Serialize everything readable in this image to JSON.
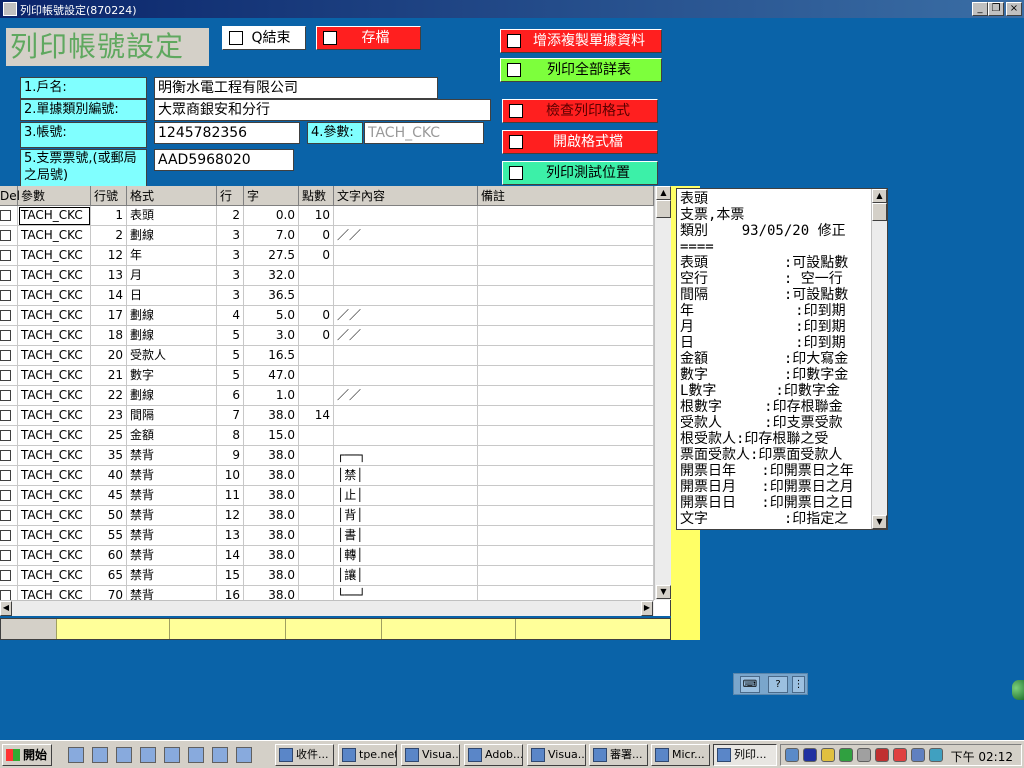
{
  "window": {
    "title": "列印帳號設定(870224)",
    "buttons": [
      "_",
      "❐",
      "×"
    ]
  },
  "form": {
    "title": "列印帳號設定",
    "buttons": {
      "quit": "Q結束",
      "save": "存檔",
      "add_copy": "增添複製單據資料",
      "print_all": "列印全部詳表",
      "check_format": "檢查列印格式",
      "open_format": "開啟格式檔",
      "print_test": "列印測試位置"
    },
    "fields": {
      "household_label": "1.戶名:",
      "household_value": "明衡水電工程有限公司",
      "doc_type_label": "2.單據類別編號:",
      "doc_type_value": "大眾商銀安和分行",
      "account_label": "3.帳號:",
      "account_value": "1245782356",
      "param_label": "4.參數:",
      "param_value": "TACH_CKC",
      "check_no_label": "5.支票票號,(或郵局之局號)",
      "check_no_value": "AAD5968020"
    }
  },
  "grid": {
    "columns": [
      "Del",
      "參數",
      "行號",
      "格式",
      "行",
      "字",
      "點數",
      "文字內容",
      "備註"
    ],
    "rows": [
      {
        "param": "TACH_CKC",
        "no": "1",
        "fmt": "表頭",
        "line": "2",
        "char": "0.0",
        "pts": "10",
        "text": ""
      },
      {
        "param": "TACH_CKC",
        "no": "2",
        "fmt": "劃線",
        "line": "3",
        "char": "7.0",
        "pts": "0",
        "text": "／／"
      },
      {
        "param": "TACH_CKC",
        "no": "12",
        "fmt": "年",
        "line": "3",
        "char": "27.5",
        "pts": "0",
        "text": ""
      },
      {
        "param": "TACH_CKC",
        "no": "13",
        "fmt": "月",
        "line": "3",
        "char": "32.0",
        "pts": "",
        "text": ""
      },
      {
        "param": "TACH_CKC",
        "no": "14",
        "fmt": "日",
        "line": "3",
        "char": "36.5",
        "pts": "",
        "text": ""
      },
      {
        "param": "TACH_CKC",
        "no": "17",
        "fmt": "劃線",
        "line": "4",
        "char": "5.0",
        "pts": "0",
        "text": "／／"
      },
      {
        "param": "TACH_CKC",
        "no": "18",
        "fmt": "劃線",
        "line": "5",
        "char": "3.0",
        "pts": "0",
        "text": "／／"
      },
      {
        "param": "TACH_CKC",
        "no": "20",
        "fmt": "受款人",
        "line": "5",
        "char": "16.5",
        "pts": "",
        "text": ""
      },
      {
        "param": "TACH_CKC",
        "no": "21",
        "fmt": "數字",
        "line": "5",
        "char": "47.0",
        "pts": "",
        "text": ""
      },
      {
        "param": "TACH_CKC",
        "no": "22",
        "fmt": "劃線",
        "line": "6",
        "char": "1.0",
        "pts": "",
        "text": "／／"
      },
      {
        "param": "TACH_CKC",
        "no": "23",
        "fmt": "間隔",
        "line": "7",
        "char": "38.0",
        "pts": "14",
        "text": ""
      },
      {
        "param": "TACH_CKC",
        "no": "25",
        "fmt": "金額",
        "line": "8",
        "char": "15.0",
        "pts": "",
        "text": ""
      },
      {
        "param": "TACH_CKC",
        "no": "35",
        "fmt": "禁背",
        "line": "9",
        "char": "38.0",
        "pts": "",
        "text": "┌──┐"
      },
      {
        "param": "TACH_CKC",
        "no": "40",
        "fmt": "禁背",
        "line": "10",
        "char": "38.0",
        "pts": "",
        "text": "│禁│"
      },
      {
        "param": "TACH_CKC",
        "no": "45",
        "fmt": "禁背",
        "line": "11",
        "char": "38.0",
        "pts": "",
        "text": "│止│"
      },
      {
        "param": "TACH_CKC",
        "no": "50",
        "fmt": "禁背",
        "line": "12",
        "char": "38.0",
        "pts": "",
        "text": "│背│"
      },
      {
        "param": "TACH_CKC",
        "no": "55",
        "fmt": "禁背",
        "line": "13",
        "char": "38.0",
        "pts": "",
        "text": "│書│"
      },
      {
        "param": "TACH_CKC",
        "no": "60",
        "fmt": "禁背",
        "line": "14",
        "char": "38.0",
        "pts": "",
        "text": "│轉│"
      },
      {
        "param": "TACH_CKC",
        "no": "65",
        "fmt": "禁背",
        "line": "15",
        "char": "38.0",
        "pts": "",
        "text": "│讓│"
      },
      {
        "param": "TACH_CKC",
        "no": "70",
        "fmt": "禁背",
        "line": "16",
        "char": "38.0",
        "pts": "",
        "text": "└──┘"
      }
    ]
  },
  "memo": {
    "lines": [
      "表頭",
      "支票,本票",
      "類別    93/05/20 修正",
      "====",
      "表頭         :可設點數",
      "空行         : 空一行",
      "間隔         :可設點數",
      "年            :印到期",
      "月            :印到期",
      "日            :印到期",
      "金額         :印大寫金",
      "數字         :印數字金",
      "L數字       :印數字金",
      "根數字     :印存根聯金",
      "受款人     :印支票受款",
      "根受款人:印存根聯之受",
      "票面受款人:印票面受款人",
      "開票日年   :印開票日之年",
      "開票日月   :印開票日之月",
      "開票日日   :印開票日之日",
      "文字         :印指定之"
    ]
  },
  "taskbar": {
    "start": "開始",
    "tasks": [
      "收件...",
      "tpe.net",
      "Visua...",
      "Adob...",
      "Visua...",
      "審署...",
      "Micr...",
      "列印..."
    ],
    "clock": "下午 02:12"
  },
  "colors": {
    "desktop": "#0a63a8",
    "label_bg": "#80ffff",
    "red_btn": "#ff1f1f",
    "green_btn": "#7dff3c",
    "mint_btn": "#3cf0a8",
    "footer": "#ffff99"
  }
}
